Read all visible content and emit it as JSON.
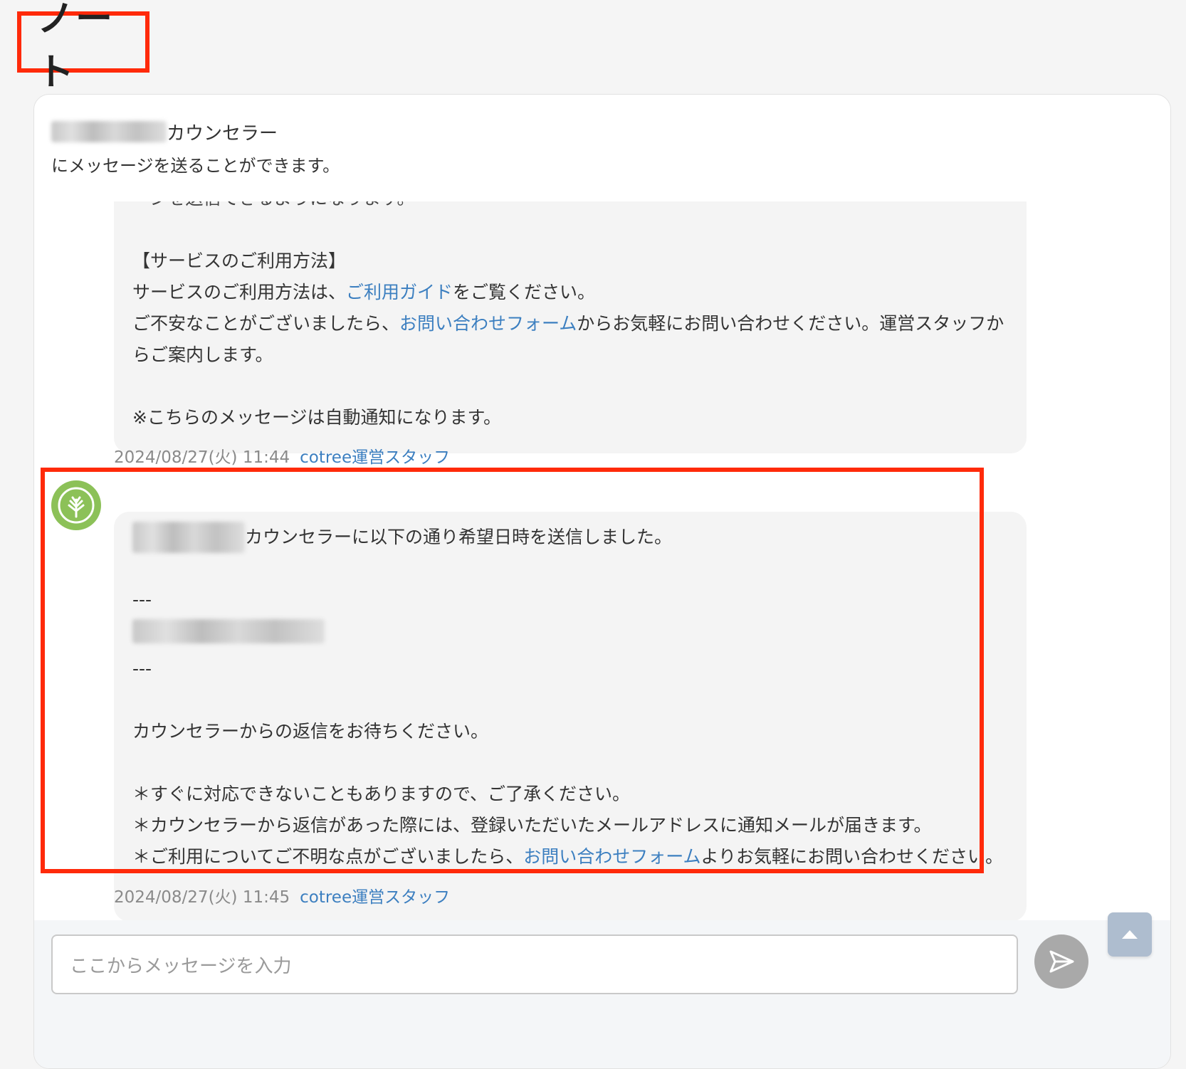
{
  "page_title": "ノート",
  "header": {
    "counselor_suffix": "カウンセラー",
    "subtitle": "にメッセージを送ることができます。"
  },
  "message1": {
    "cut_line": "ージを送信できるようになります。",
    "section_title": "【サービスのご利用方法】",
    "line1_pre": "サービスのご利用方法は、",
    "line1_link": "ご利用ガイド",
    "line1_post": "をご覧ください。",
    "line2_pre": "ご不安なことがございましたら、",
    "line2_link": "お問い合わせフォーム",
    "line2_post": "からお気軽にお問い合わせください。運営スタッフからご案内します。",
    "notice": "※こちらのメッセージは自動通知になります。",
    "timestamp": "2024/08/27(火) 11:44",
    "sender": "cotree運営スタッフ"
  },
  "message2": {
    "line1_post": "カウンセラーに以下の通り希望日時を送信しました。",
    "separator": "---",
    "wait": "カウンセラーからの返信をお待ちください。",
    "note1": "＊すぐに対応できないこともありますので、ご了承ください。",
    "note2": "＊カウンセラーから返信があった際には、登録いただいたメールアドレスに通知メールが届きます。",
    "note3_pre": "＊ご利用についてご不明な点がございましたら、",
    "note3_link": "お問い合わせフォーム",
    "note3_post": "よりお気軽にお問い合わせください。",
    "timestamp": "2024/08/27(火) 11:45",
    "sender": "cotree運営スタッフ"
  },
  "input": {
    "placeholder": "ここからメッセージを入力"
  },
  "icons": {
    "avatar": "tree-logo-icon",
    "scroll_top": "triangle-up-icon",
    "send": "paper-plane-icon"
  },
  "colors": {
    "highlight": "#ff2a0a",
    "link": "#3c7fc0",
    "avatar_green": "#8cc158"
  }
}
